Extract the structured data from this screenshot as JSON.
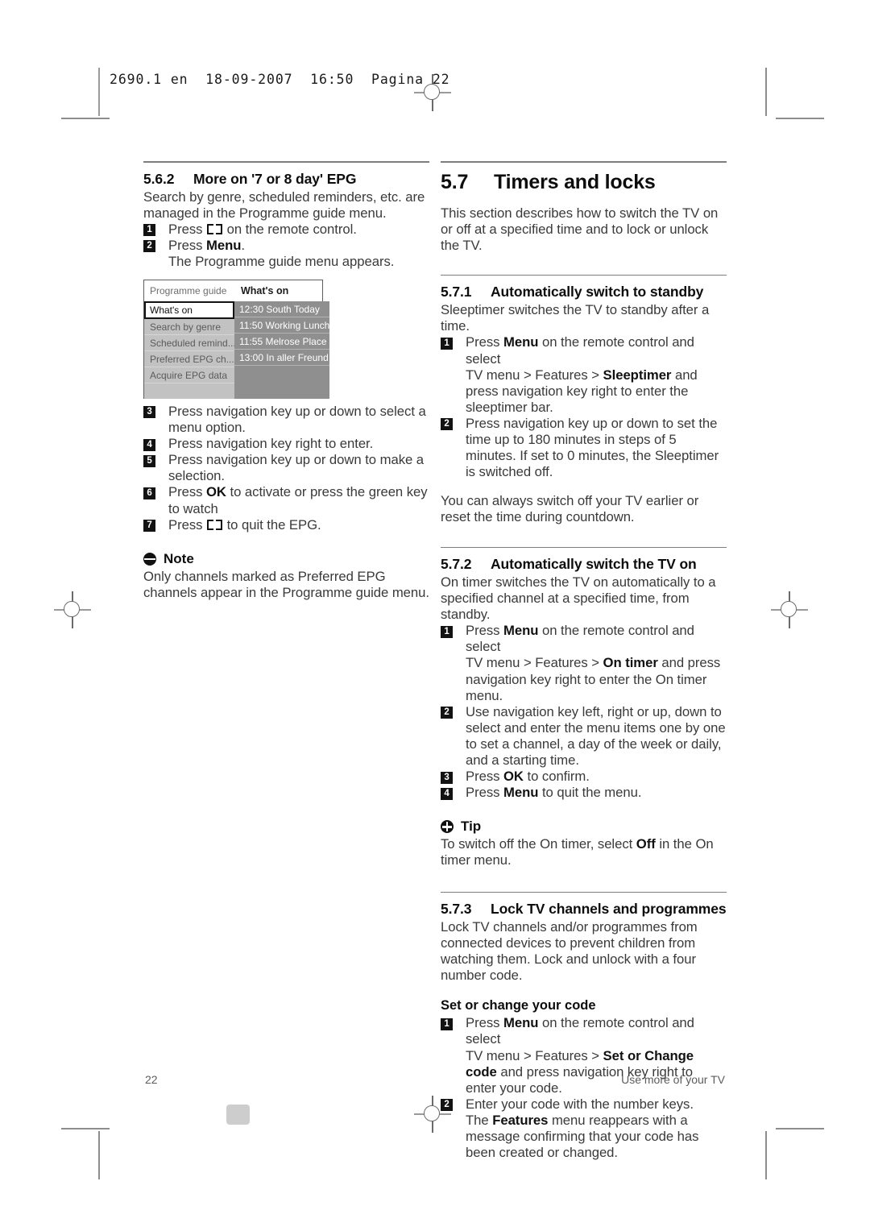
{
  "print_slug": "2690.1 en  18-09-2007  16:50  Pagina 22",
  "left_column": {
    "section": {
      "number": "5.6.2",
      "title": "More on '7 or 8 day' EPG",
      "intro": "Search by genre, scheduled reminders, etc. are managed in the Programme guide menu.",
      "steps": [
        {
          "pre": "Press ",
          "icon": "book-icon",
          "post": " on the remote control."
        },
        {
          "pre": "Press ",
          "bold": "Menu",
          "post": ".",
          "cont": "The Programme guide menu appears."
        }
      ]
    },
    "tv_mock": {
      "title_left": "Programme guide",
      "title_right": "What's on",
      "menu_items": [
        {
          "label": "What's on",
          "selected": true
        },
        {
          "label": "Search by genre",
          "selected": false
        },
        {
          "label": "Scheduled remind...",
          "selected": false
        },
        {
          "label": "Preferred EPG ch...",
          "selected": false
        },
        {
          "label": "Acquire EPG data",
          "selected": false
        },
        {
          "label": "",
          "selected": false
        }
      ],
      "programmes": [
        "12:30 South Today",
        "11:50 Working Lunch",
        "11:55 Melrose Place",
        "13:00 In aller Freund",
        "",
        ""
      ],
      "colors": {
        "menu_bg": "#c2c2c2",
        "programme_bg": "#8f8f8f",
        "selected_bg": "#ffffff",
        "selected_border": "#131313"
      }
    },
    "steps_after": [
      {
        "text": "Press navigation key up or down to select a menu option."
      },
      {
        "text": "Press navigation key right to enter."
      },
      {
        "text": "Press navigation key up or down to make a selection."
      },
      {
        "pre": "Press ",
        "bold": "OK",
        "post": " to activate or press the green key to watch"
      },
      {
        "pre": "Press ",
        "icon": "book-icon",
        "post": " to quit the EPG."
      }
    ],
    "note": {
      "icon": "note-icon",
      "label": "Note",
      "text": "Only channels marked as Preferred EPG channels appear in the Programme guide menu."
    }
  },
  "right_column": {
    "chapter": {
      "number": "5.7",
      "title": "Timers and locks",
      "intro": "This section describes how to switch the TV on or off at a specified time and to lock or unlock the TV."
    },
    "section_571": {
      "number": "5.7.1",
      "title": "Automatically switch to standby",
      "intro": "Sleeptimer switches the TV to standby after a time.",
      "steps": [
        {
          "pre": "Press ",
          "bold": "Menu",
          "post": " on the remote control and select",
          "cont_pre": "TV menu > Features > ",
          "cont_bold": "Sleeptimer",
          "cont_post": " and press navigation key right to enter the sleeptimer bar."
        },
        {
          "text": "Press navigation key up or down to set the time up to 180 minutes in steps of 5 minutes. If set to 0 minutes, the Sleeptimer is switched off."
        }
      ],
      "outro": "You can always switch off your TV earlier or reset the time during countdown."
    },
    "section_572": {
      "number": "5.7.2",
      "title": "Automatically switch the TV on",
      "intro": "On timer switches the TV on automatically to a specified channel at a specified time, from standby.",
      "steps": [
        {
          "pre": "Press ",
          "bold": "Menu",
          "post": " on the remote control and select",
          "cont_pre": "TV menu > Features > ",
          "cont_bold": "On timer",
          "cont_post": " and press navigation key right to enter the On timer menu."
        },
        {
          "text": "Use navigation key left, right or up, down to select and enter the menu items one by one to set a channel, a day of the week or daily, and a starting time."
        },
        {
          "pre": "Press ",
          "bold": "OK",
          "post": " to confirm."
        },
        {
          "pre": "Press ",
          "bold": "Menu",
          "post": " to quit the menu."
        }
      ],
      "tip": {
        "icon": "tip-icon",
        "label": "Tip",
        "pre": "To switch off the On timer, select ",
        "bold": "Off",
        "post": " in the On timer menu."
      }
    },
    "section_573": {
      "number": "5.7.3",
      "title": "Lock TV channels and programmes",
      "intro": "Lock TV channels and/or programmes from connected devices to prevent children from watching them. Lock and unlock with a four number code.",
      "subhead": "Set or change your code",
      "steps": [
        {
          "pre": "Press ",
          "bold": "Menu",
          "post": " on the remote control and select",
          "cont_pre": "TV menu > Features > ",
          "cont_bold": "Set or Change code",
          "cont_post": " and press navigation key right to enter your code."
        },
        {
          "text_pre": "Enter your code with the number keys.",
          "cont_pre": "The ",
          "cont_bold": "Features",
          "cont_post": " menu reappears with a message confirming that your code has been created or changed."
        }
      ]
    }
  },
  "footer": {
    "page_number": "22",
    "chapter_label": "Use more of your TV"
  }
}
